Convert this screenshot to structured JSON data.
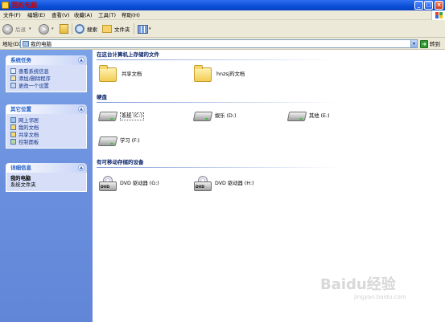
{
  "window": {
    "title": "我的电脑"
  },
  "menu": [
    "文件(F)",
    "编辑(E)",
    "查看(V)",
    "收藏(A)",
    "工具(T)",
    "帮助(H)"
  ],
  "toolbar": {
    "back": "后退",
    "search": "搜索",
    "folders": "文件夹"
  },
  "address": {
    "label": "地址(D)",
    "value": "我的电脑",
    "go": "转到"
  },
  "sidebar": {
    "system_tasks": {
      "title": "系统任务",
      "items": [
        "查看系统信息",
        "添加/删除程序",
        "更改一个设置"
      ]
    },
    "other_places": {
      "title": "其它位置",
      "items": [
        "网上邻居",
        "我的文档",
        "共享文档",
        "控制面板"
      ]
    },
    "details": {
      "title": "详细信息",
      "name": "我的电脑",
      "desc": "系统文件夹"
    }
  },
  "groups": {
    "files": {
      "title": "在这台计算机上存储的文件",
      "items": [
        "共享文档",
        "hnzsj的文档"
      ]
    },
    "drives": {
      "title": "硬盘",
      "items": [
        "系统 (C:)",
        "娱乐 (D:)",
        "其他 (E:)",
        "学习 (F:)"
      ]
    },
    "removable": {
      "title": "有可移动存储的设备",
      "items": [
        "DVD 驱动器 (G:)",
        "DVD 驱动器 (H:)"
      ]
    }
  },
  "watermark": {
    "brand": "Baidu经验",
    "url": "jingyan.baidu.com"
  }
}
